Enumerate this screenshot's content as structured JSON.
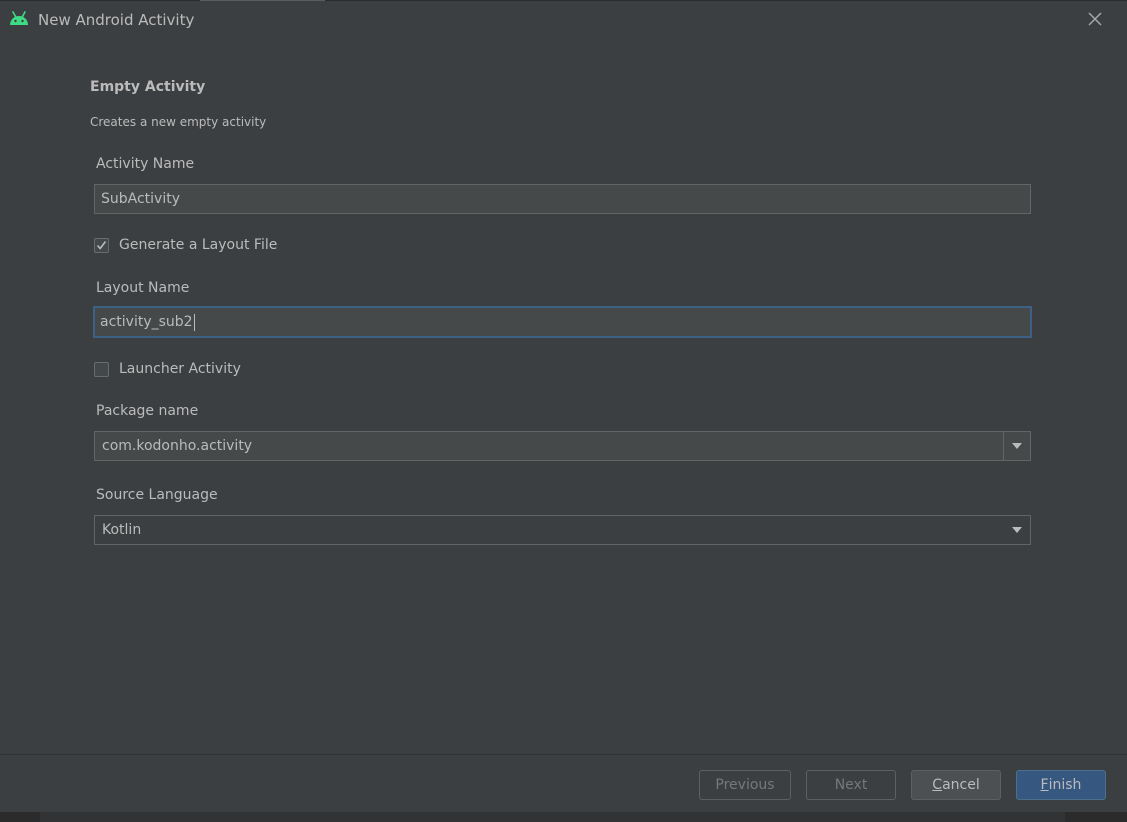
{
  "window": {
    "title": "New Android Activity"
  },
  "template": {
    "heading": "Empty Activity",
    "description": "Creates a new empty activity"
  },
  "form": {
    "activity_name": {
      "label": "Activity Name",
      "value": "SubActivity"
    },
    "generate_layout": {
      "label": "Generate a Layout File",
      "checked": true
    },
    "layout_name": {
      "label": "Layout Name",
      "value": "activity_sub2"
    },
    "launcher_activity": {
      "label": "Launcher Activity",
      "checked": false
    },
    "package_name": {
      "label": "Package name",
      "value": "com.kodonho.activity"
    },
    "source_language": {
      "label": "Source Language",
      "value": "Kotlin"
    }
  },
  "buttons": {
    "previous": "Previous",
    "next": "Next",
    "cancel_mnemonic": "C",
    "cancel_rest": "ancel",
    "finish_mnemonic": "F",
    "finish_rest": "inish"
  },
  "colors": {
    "background": "#3c3f41",
    "android_green": "#3ddc84",
    "focus_border": "#3d6185",
    "primary_button": "#365880"
  }
}
